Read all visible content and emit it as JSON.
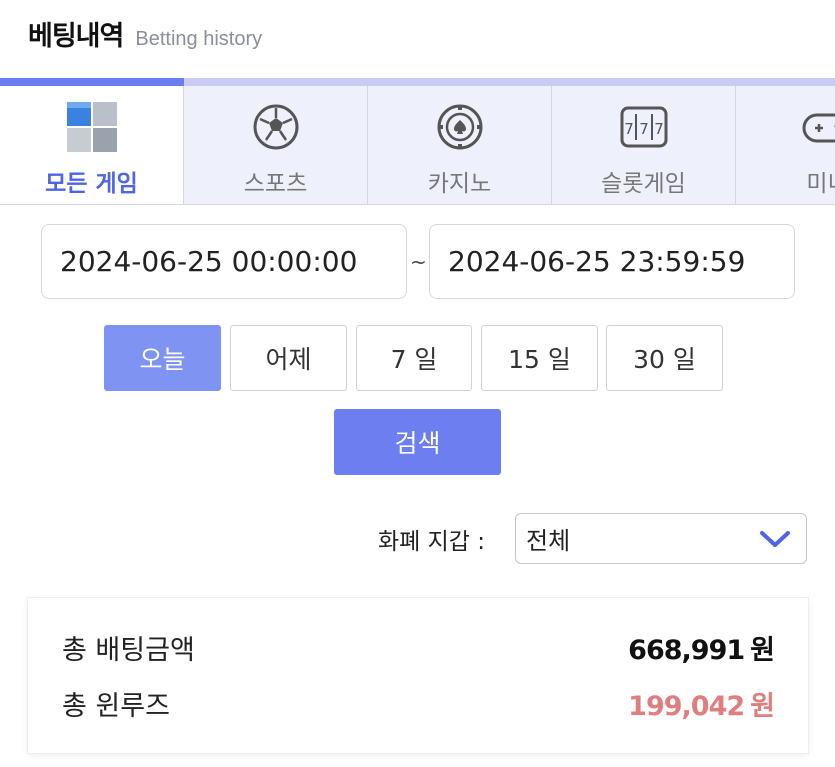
{
  "header": {
    "title": "베팅내역",
    "subtitle": "Betting history"
  },
  "tabs": [
    {
      "label": "모든 게임",
      "icon": "cube-grid-icon",
      "active": true
    },
    {
      "label": "스포츠",
      "icon": "soccer-ball-icon",
      "active": false
    },
    {
      "label": "카지노",
      "icon": "casino-chip-icon",
      "active": false
    },
    {
      "label": "슬롯게임",
      "icon": "slot-machine-icon",
      "active": false
    },
    {
      "label": "미니",
      "icon": "gamepad-icon",
      "active": false
    }
  ],
  "date_range": {
    "from": "2024-06-25 00:00:00",
    "separator": "~",
    "to": "2024-06-25 23:59:59"
  },
  "quick_ranges": [
    {
      "label": "오늘",
      "active": true
    },
    {
      "label": "어제",
      "active": false
    },
    {
      "label": "7 일",
      "active": false
    },
    {
      "label": "15 일",
      "active": false
    },
    {
      "label": "30 일",
      "active": false
    }
  ],
  "search_label": "검색",
  "currency": {
    "label": "화폐 지갑 :",
    "selected": "전체"
  },
  "summary": {
    "total_bet_label": "총 배팅금액",
    "total_bet_value": "668,991",
    "total_win_label": "총 윈루즈",
    "total_win_value": "199,042",
    "unit": "원"
  },
  "colors": {
    "accent": "#6d7ff0",
    "active_tab_text": "#4f64e6",
    "loss_red": "#e07d7d"
  }
}
